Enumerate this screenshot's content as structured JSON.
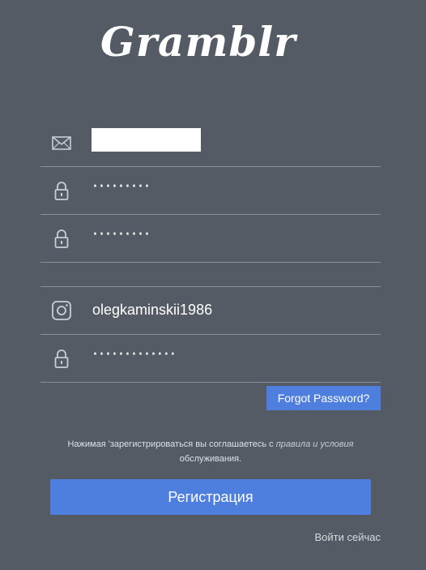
{
  "app": {
    "logo": "Gramblr"
  },
  "form": {
    "email": {
      "icon": "envelope-icon",
      "value": ""
    },
    "password": {
      "icon": "lock-icon",
      "value": "·········"
    },
    "password_confirm": {
      "icon": "lock-icon",
      "value": "·········"
    },
    "instagram_username": {
      "icon": "instagram-icon",
      "value": "olegkaminskii1986"
    },
    "instagram_password": {
      "icon": "lock-icon",
      "value": "·············"
    }
  },
  "forgot_password_label": "Forgot Password?",
  "terms": {
    "prefix": "Нажимая 'зарегистрироваться вы соглашаетесь с",
    "link_italic": "правила и условия",
    "suffix": "обслуживания."
  },
  "register_label": "Регистрация",
  "login_now_label": "Войти сейчас",
  "colors": {
    "background": "#545b65",
    "accent": "#4f7fde"
  }
}
